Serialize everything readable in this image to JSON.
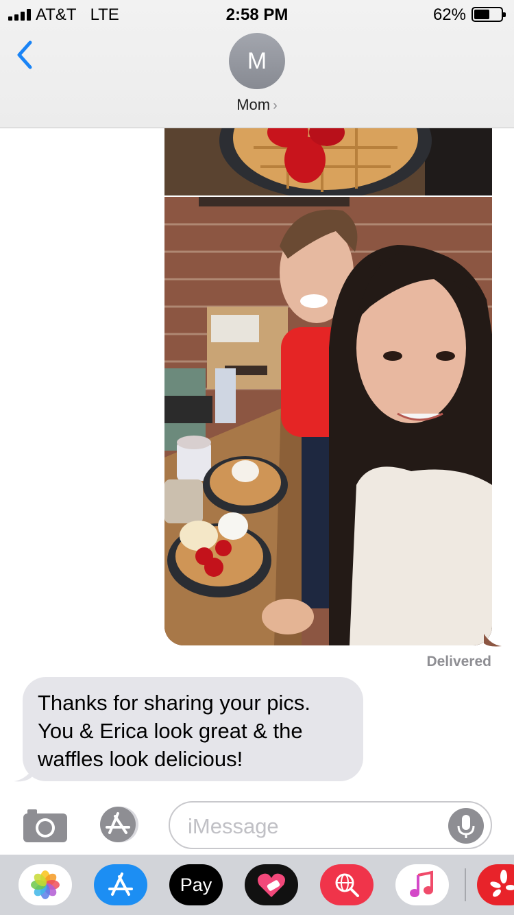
{
  "status_bar": {
    "carrier": "AT&T",
    "network": "LTE",
    "time": "2:58 PM",
    "battery_percent": "62%",
    "battery_level": 0.62
  },
  "header": {
    "avatar_initial": "M",
    "contact_name": "Mom",
    "chevron": "›"
  },
  "conversation": {
    "delivered_label": "Delivered",
    "incoming_message": "Thanks for sharing your pics. You & Erica look great & the waffles look delicious!"
  },
  "input_bar": {
    "placeholder": "iMessage"
  },
  "app_drawer": {
    "pay_label": "Pay",
    "apple_glyph": ""
  },
  "colors": {
    "accent": "#1a84f6",
    "incoming_bubble": "#e5e5ea",
    "delivered_text": "#8e8e93"
  }
}
